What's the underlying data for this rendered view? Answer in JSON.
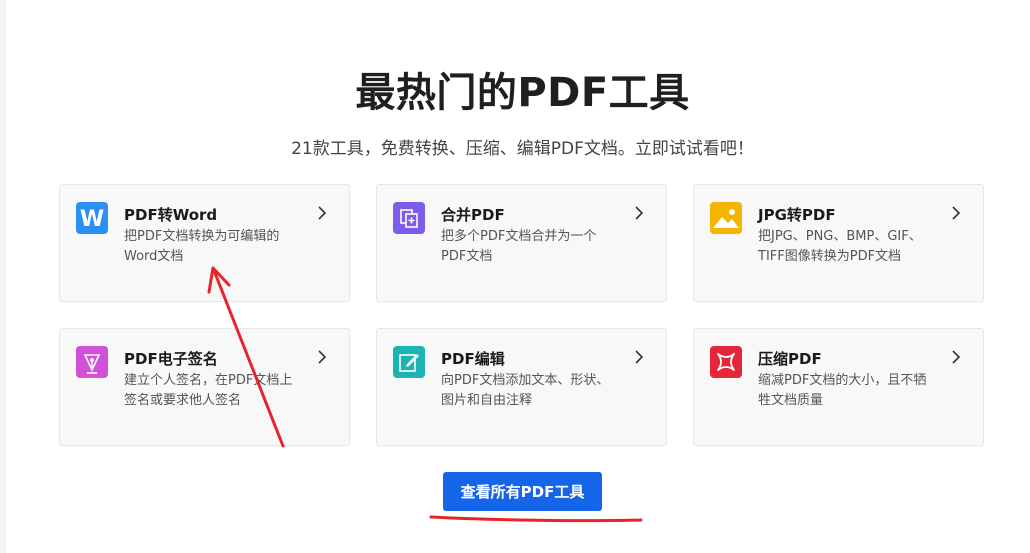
{
  "heading": "最热门的PDF工具",
  "subheading": "21款工具，免费转换、压缩、编辑PDF文档。立即试试看吧！",
  "tools": [
    {
      "title": "PDF转Word",
      "desc": "把PDF文档转换为可编辑的Word文档",
      "icon": "word-icon",
      "color": "#2b8ff3"
    },
    {
      "title": "合并PDF",
      "desc": "把多个PDF文档合并为一个PDF文档",
      "icon": "merge-icon",
      "color": "#7c5ce8"
    },
    {
      "title": "JPG转PDF",
      "desc": "把JPG、PNG、BMP、GIF、TIFF图像转换为PDF文档",
      "icon": "image-icon",
      "color": "#f5b400"
    },
    {
      "title": "PDF电子签名",
      "desc": "建立个人签名，在PDF文档上签名或要求他人签名",
      "icon": "pen-nib-icon",
      "color": "#d24fd8"
    },
    {
      "title": "PDF编辑",
      "desc": "向PDF文档添加文本、形状、图片和自由注释",
      "icon": "edit-icon",
      "color": "#1bb3b3"
    },
    {
      "title": "压缩PDF",
      "desc": "缩减PDF文档的大小，且不牺牲文档质量",
      "icon": "compress-icon",
      "color": "#e5253a"
    }
  ],
  "cta_label": "查看所有PDF工具",
  "colors": {
    "cta": "#1565e8",
    "annotation": "#e8242b"
  }
}
